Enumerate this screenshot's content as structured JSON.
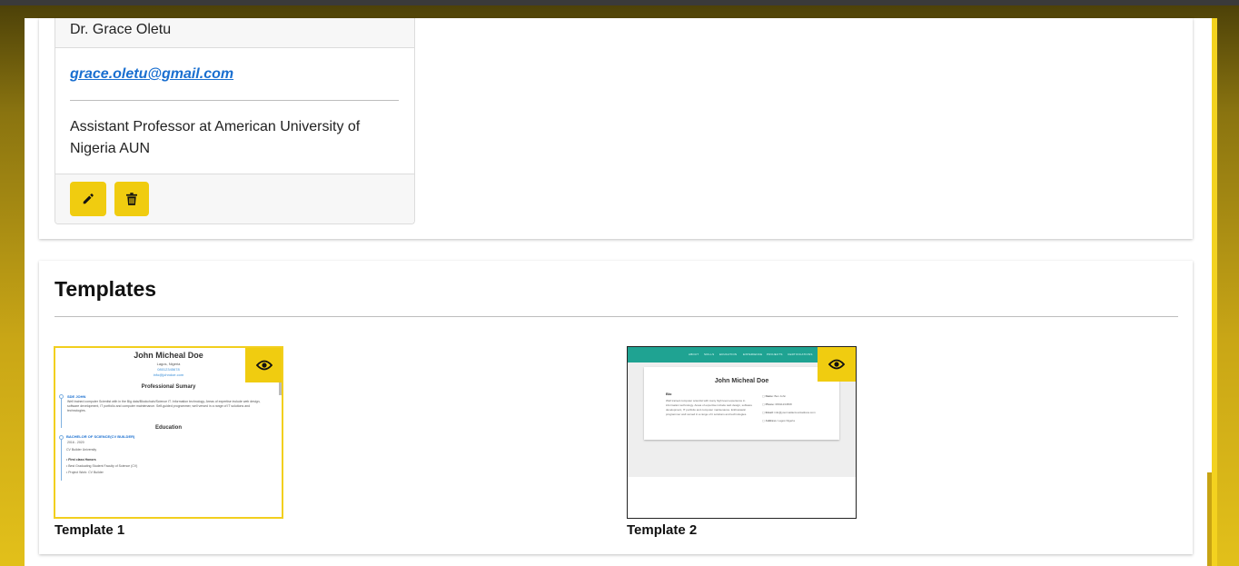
{
  "person": {
    "name": "Dr. Grace Oletu",
    "email": "grace.oletu@gmail.com",
    "bio": "Assistant Professor at American University of Nigeria AUN",
    "edit_icon": "pencil-icon",
    "delete_icon": "trash-icon"
  },
  "templates": {
    "title": "Templates",
    "items": [
      {
        "label": "Template 1",
        "preview": {
          "name": "John Micheal Doe",
          "location": "Lagos, Nigeria",
          "phone": "08012345678",
          "email": "info@johndoe.com",
          "summary_heading": "Professional Sumary",
          "summary_role": "SDE JOHN",
          "summary_text": "Well trained computer Scientist with in the Big data/Blockchain/Science IT. Information technology. Areas of expertise include web design, software development, IT portfolio and computer maintenance. Self-guided programmer, well versed in a range of IT solutions and technologies.",
          "education_heading": "Education",
          "degree": "BACHELOR OF SCIENCE(CV BUILDER)",
          "years": "2016 - 2020",
          "school": "CV Builder University",
          "bullets": [
            "First class Honors",
            "Best Graduating Student Faculty of Science (CV)",
            "Project Work: CV Builder"
          ]
        }
      },
      {
        "label": "Template 2",
        "preview": {
          "nav": [
            "ABOUT",
            "SKILLS",
            "EDUCATION",
            "EXPERIENCE",
            "PROJECTS",
            "CERTIFICATIONS"
          ],
          "name": "John Micheal Doe",
          "bio_heading": "Bio",
          "bio_text": "Well trained computer scientist with many high level experience in information technology. Areas of expertise include web design, software development, IT portfolio and computer maintenance. Enthusiastic programmer well versed in a range of it solutions and technologies.",
          "contacts": [
            {
              "key": "Name",
              "value": "Ben John"
            },
            {
              "key": "Phone",
              "value": "08011234568"
            },
            {
              "key": "Email",
              "value": "info@yourmailaccountadress.com"
            },
            {
              "key": "Address",
              "value": "Lagos Nigeria"
            }
          ]
        }
      }
    ],
    "view_icon": "eye-icon"
  }
}
